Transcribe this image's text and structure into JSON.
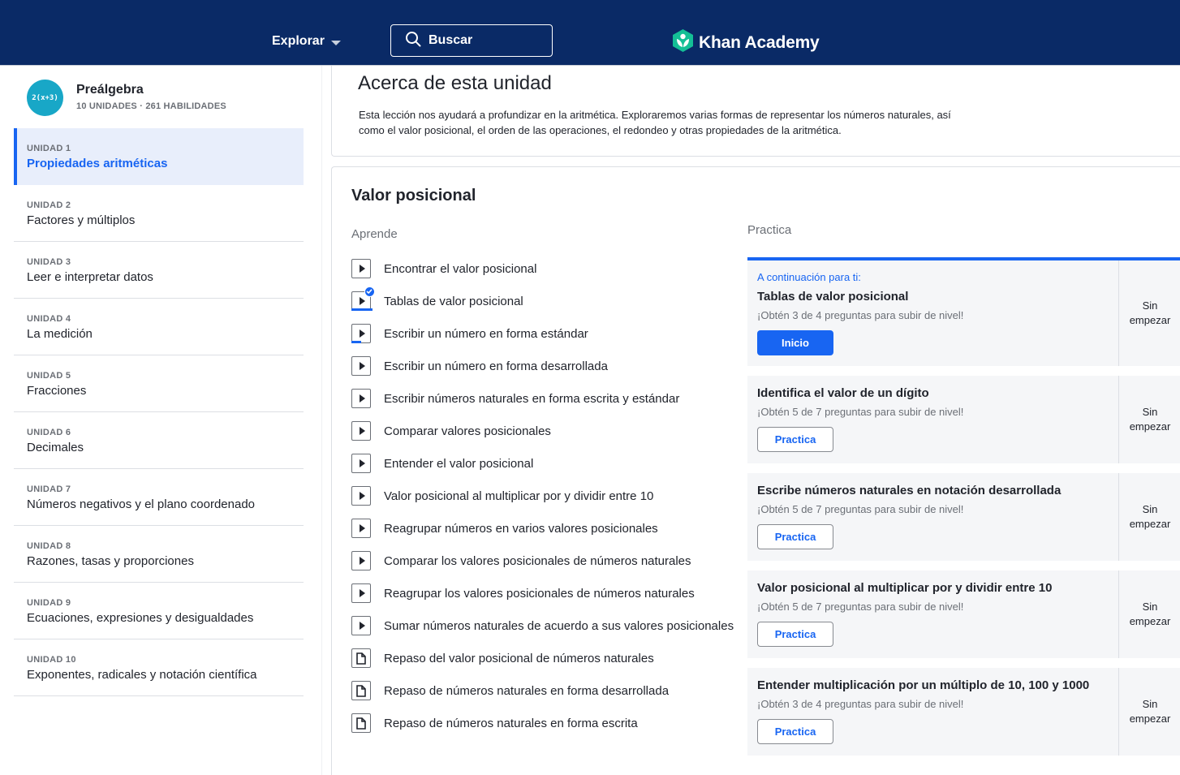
{
  "topbar": {
    "explore_label": "Explorar",
    "search_placeholder": "Buscar",
    "brand_name": "Khan Academy",
    "colors": {
      "background": "#0a2a66",
      "brand_green": "#14bf96"
    }
  },
  "sidebar": {
    "course": {
      "icon_text": "2(x+3)",
      "title": "Preálgebra",
      "subtitle": "10 UNIDADES · 261 HABILIDADES"
    },
    "units": [
      {
        "number": "UNIDAD 1",
        "name": "Propiedades aritméticas",
        "active": true
      },
      {
        "number": "UNIDAD 2",
        "name": "Factores y múltiplos"
      },
      {
        "number": "UNIDAD 3",
        "name": "Leer e interpretar datos"
      },
      {
        "number": "UNIDAD 4",
        "name": "La medición"
      },
      {
        "number": "UNIDAD 5",
        "name": "Fracciones"
      },
      {
        "number": "UNIDAD 6",
        "name": "Decimales"
      },
      {
        "number": "UNIDAD 7",
        "name": "Números negativos y el plano coordenado"
      },
      {
        "number": "UNIDAD 8",
        "name": "Razones, tasas y proporciones"
      },
      {
        "number": "UNIDAD 9",
        "name": "Ecuaciones, expresiones y desigualdades"
      },
      {
        "number": "UNIDAD 10",
        "name": "Exponentes, radicales y notación científica"
      }
    ]
  },
  "about": {
    "title": "Acerca de esta unidad",
    "description": "Esta lección nos ayudará a profundizar en la aritmética. Exploraremos varias formas de representar los números naturales, así como el valor posicional, el orden de las operaciones, el redondeo y otras propiedades de la  aritmética."
  },
  "lesson": {
    "title": "Valor posicional",
    "learn_heading": "Aprende",
    "practice_heading": "Practica",
    "learn_items": [
      {
        "label": "Encontrar el valor posicional",
        "type": "video",
        "progress": 0
      },
      {
        "label": "Tablas de valor posicional",
        "type": "video",
        "progress": 1.0,
        "completed": true
      },
      {
        "label": "Escribir un número en forma estándar",
        "type": "video",
        "progress": 0.45
      },
      {
        "label": "Escribir un número en forma desarrollada",
        "type": "video",
        "progress": 0
      },
      {
        "label": "Escribir números naturales en forma escrita y estándar",
        "type": "video",
        "progress": 0
      },
      {
        "label": "Comparar valores posicionales",
        "type": "video",
        "progress": 0
      },
      {
        "label": "Entender el valor posicional",
        "type": "video",
        "progress": 0
      },
      {
        "label": "Valor posicional al multiplicar por y dividir entre 10",
        "type": "video",
        "progress": 0
      },
      {
        "label": "Reagrupar números en varios valores posicionales",
        "type": "video",
        "progress": 0
      },
      {
        "label": "Comparar los valores posicionales de números naturales",
        "type": "video",
        "progress": 0
      },
      {
        "label": "Reagrupar los valores posicionales de números naturales",
        "type": "video",
        "progress": 0
      },
      {
        "label": "Sumar números naturales de acuerdo a sus valores posicionales",
        "type": "video",
        "progress": 0
      },
      {
        "label": "Repaso del valor posicional de números naturales",
        "type": "article"
      },
      {
        "label": "Repaso de números naturales en forma desarrollada",
        "type": "article"
      },
      {
        "label": "Repaso de números naturales en forma escrita",
        "type": "article"
      }
    ],
    "practice_items": [
      {
        "next_label": "A continuación para ti:",
        "title": "Tablas de valor posicional",
        "subtitle": "¡Obtén 3 de 4 preguntas para subir de nivel!",
        "button": "Inicio",
        "status_line1": "Sin",
        "status_line2": "empezar"
      },
      {
        "title": "Identifica el valor de un dígito",
        "subtitle": "¡Obtén 5 de 7 preguntas para subir de nivel!",
        "button": "Practica",
        "status_line1": "Sin",
        "status_line2": "empezar"
      },
      {
        "title": "Escribe números naturales en notación desarrollada",
        "subtitle": "¡Obtén 5 de 7 preguntas para subir de nivel!",
        "button": "Practica",
        "status_line1": "Sin",
        "status_line2": "empezar"
      },
      {
        "title": "Valor posicional al multiplicar por y dividir entre 10",
        "subtitle": "¡Obtén 5 de 7 preguntas para subir de nivel!",
        "button": "Practica",
        "status_line1": "Sin",
        "status_line2": "empezar"
      },
      {
        "title": "Entender multiplicación por un múltiplo de 10, 100 y 1000",
        "subtitle": "¡Obtén 3 de 4 preguntas para subir de nivel!",
        "button": "Practica",
        "status_line1": "Sin",
        "status_line2": "empezar"
      }
    ]
  }
}
